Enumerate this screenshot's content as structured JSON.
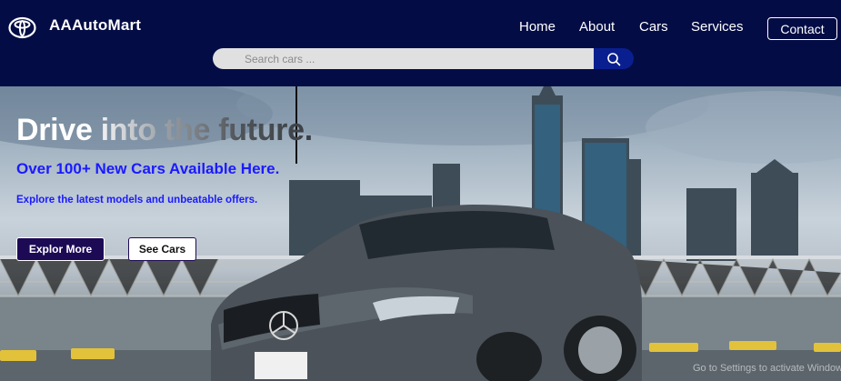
{
  "brand": {
    "name": "AAAutoMart",
    "logo_icon": "toyota-logo-icon"
  },
  "nav": {
    "items": [
      {
        "label": "Home"
      },
      {
        "label": "About"
      },
      {
        "label": "Cars"
      },
      {
        "label": "Services"
      }
    ],
    "contact_label": "Contact"
  },
  "search": {
    "placeholder": "Search cars ...",
    "value": "",
    "icon": "search-icon"
  },
  "hero": {
    "title": "Drive into the future.",
    "subtitle": "Over 100+ New Cars Available Here.",
    "description": "Explore the latest models and unbeatable offers.",
    "primary_button": "Explor More",
    "secondary_button": "See Cars"
  },
  "watermark": "Go to Settings to activate Windows.",
  "colors": {
    "header_bg": "#030c45",
    "accent_blue": "#1a1aff",
    "search_button": "#0a1f8f",
    "primary_button": "#1d0a55"
  }
}
